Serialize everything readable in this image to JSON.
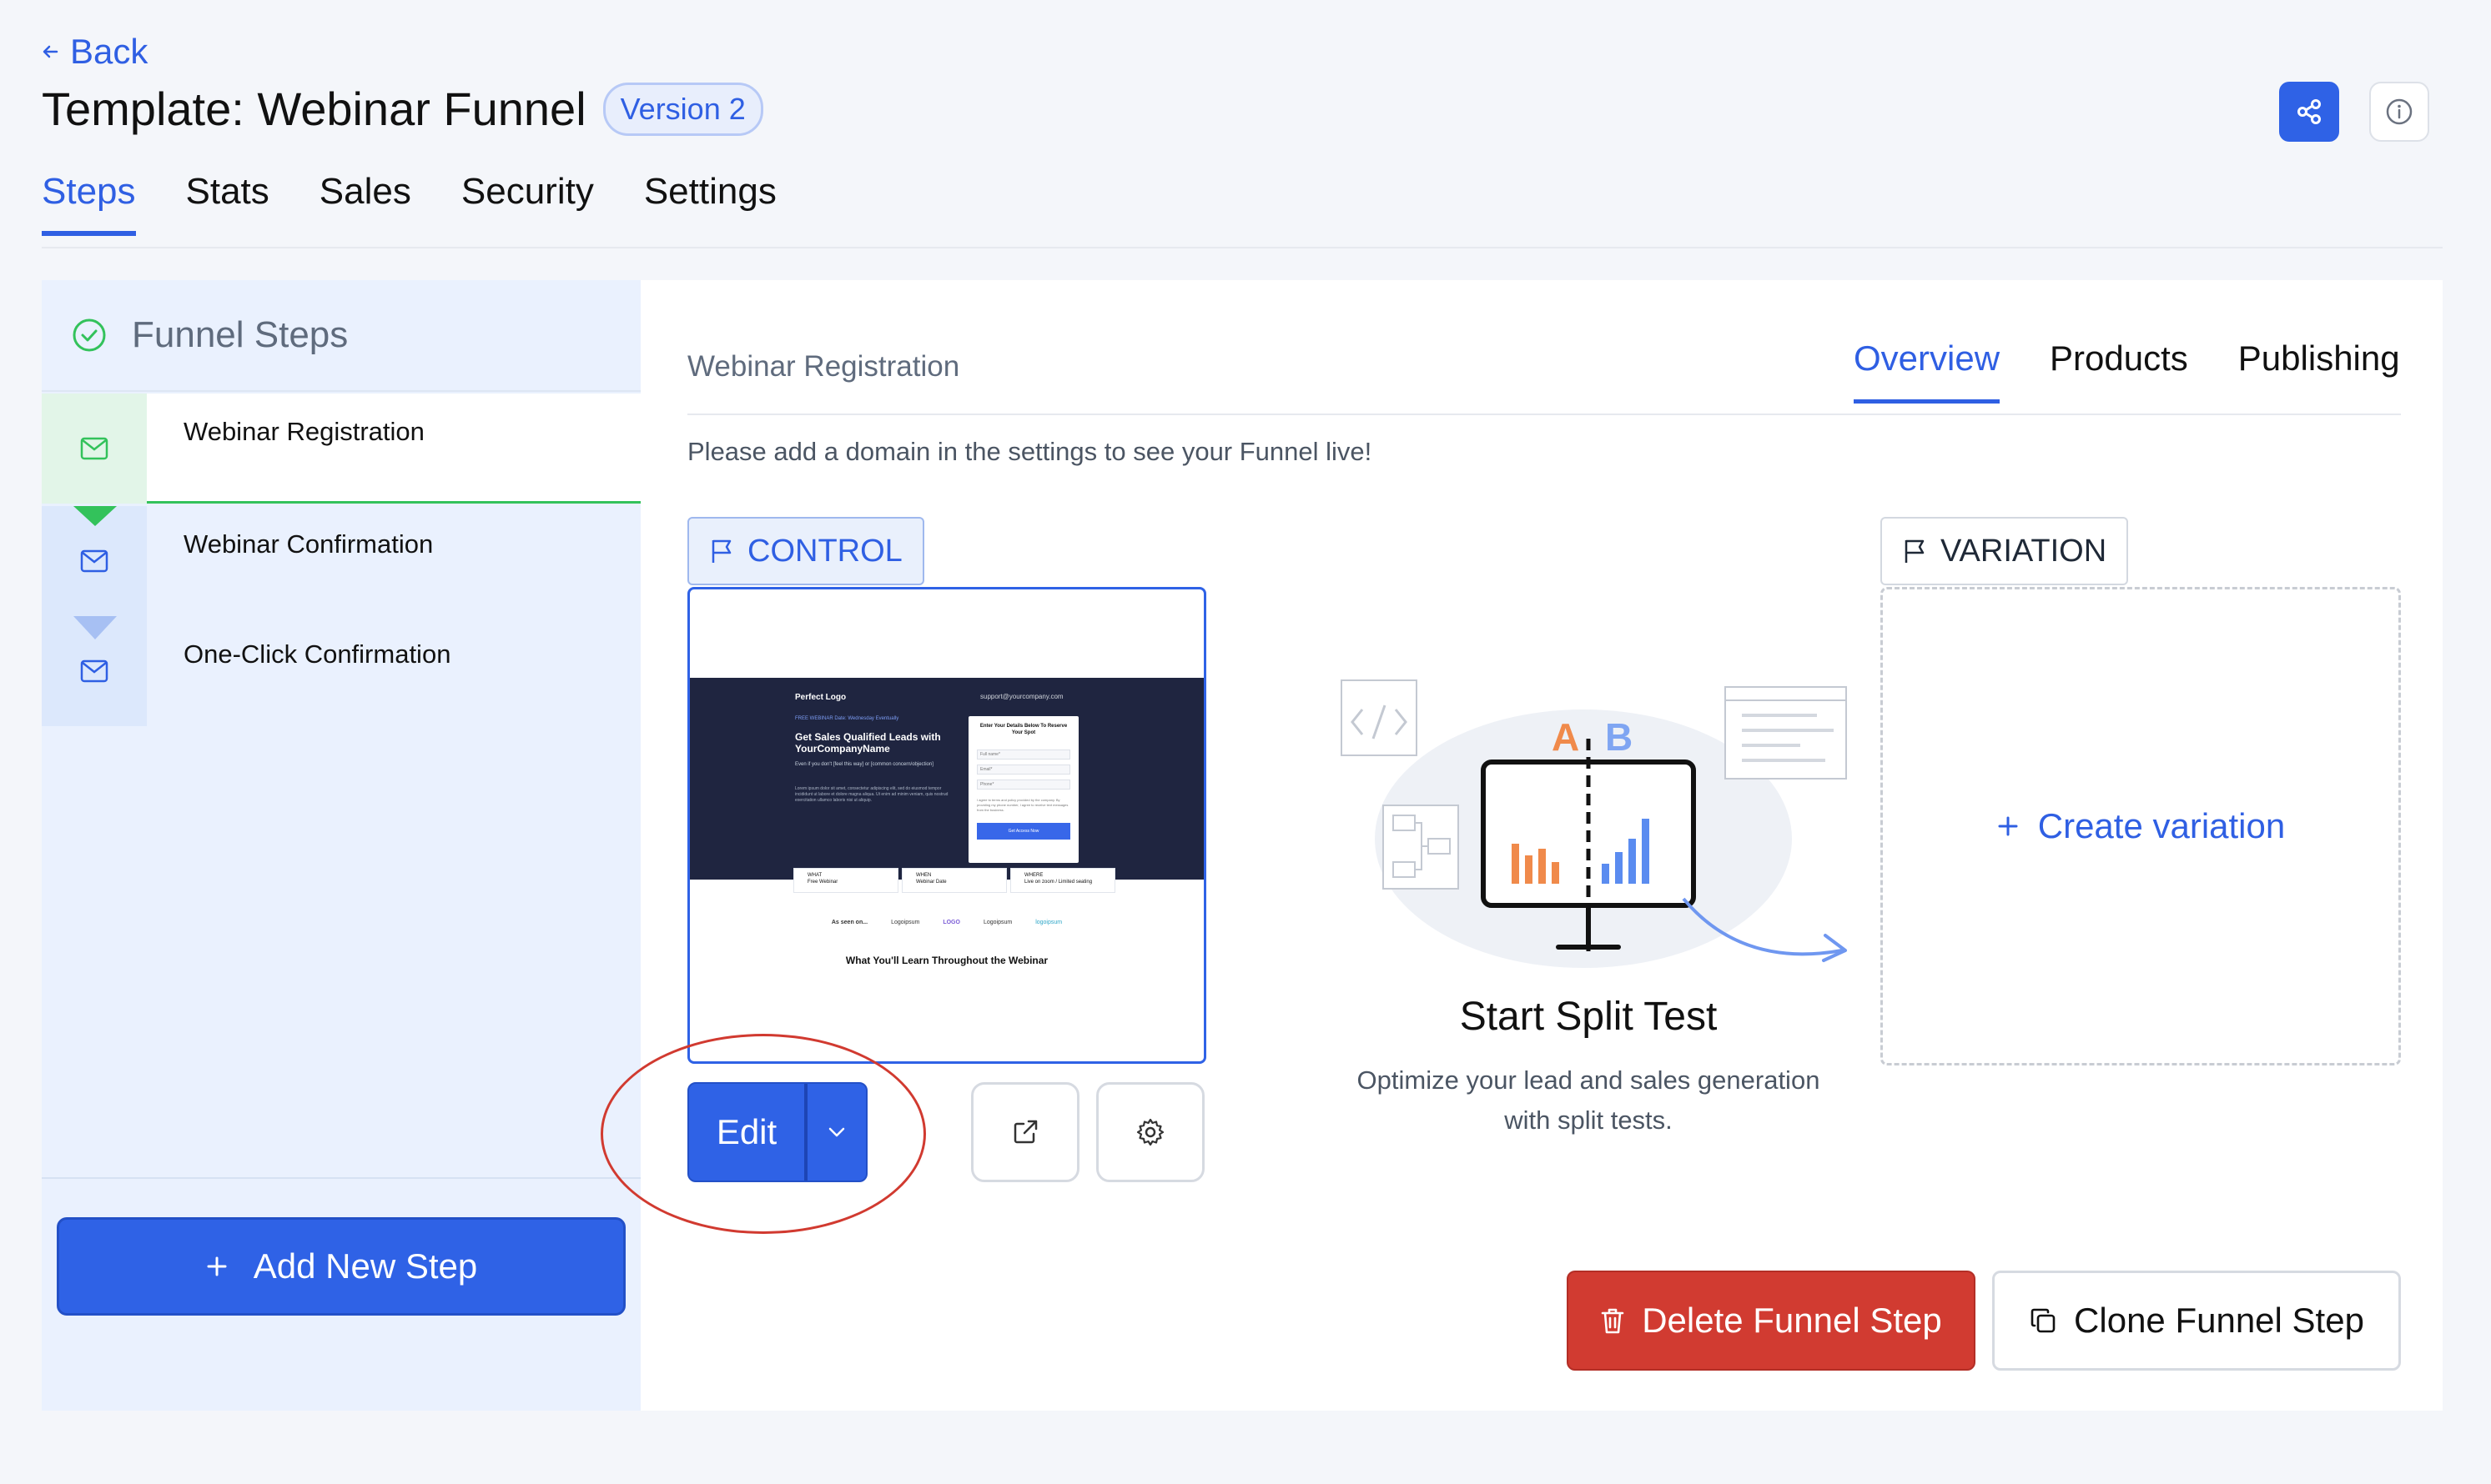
{
  "header": {
    "back_label": "Back",
    "title": "Template: Webinar Funnel",
    "version_badge": "Version 2"
  },
  "tabs": [
    "Steps",
    "Stats",
    "Sales",
    "Security",
    "Settings"
  ],
  "sidebar": {
    "title": "Funnel Steps",
    "steps": [
      {
        "label": "Webinar Registration",
        "icon": "mail-icon"
      },
      {
        "label": "Webinar Confirmation",
        "icon": "mail-icon"
      },
      {
        "label": "One-Click Confirmation",
        "icon": "mail-icon"
      }
    ],
    "add_step_label": "Add New Step"
  },
  "main": {
    "step_title": "Webinar Registration",
    "tabs": [
      "Overview",
      "Products",
      "Publishing"
    ],
    "notice": "Please add a domain in the settings to see your Funnel live!",
    "control_label": "CONTROL",
    "variation_label": "VARIATION",
    "edit_label": "Edit",
    "create_variation_label": "Create variation",
    "split_test": {
      "title": "Start Split Test",
      "description_line1": "Optimize your lead and sales generation",
      "description_line2": "with split tests.",
      "label_a": "A",
      "label_b": "B"
    },
    "delete_label": "Delete Funnel Step",
    "clone_label": "Clone Funnel Step"
  },
  "preview": {
    "logo": "Perfect Logo",
    "email": "support@yourcompany.com",
    "small_label": "FREE WEBINAR  Date: Wednesday Eventually",
    "headline": "Get Sales Qualified Leads with YourCompanyName",
    "sub": "Even if you don't [feel this way] or [common concern/objection]",
    "lorem": "Lorem ipsum dolor sit amet, consectetur adipiscing elit, sed do eiusmod tempor incididunt ut labore et dolore magna aliqua. Ut enim ad minim veniam, quis nostrud exercitation ullamco laboris nisi ut aliquip.",
    "form_title": "Enter Your Details Below To Reserve Your Spot",
    "field1": "Full name*",
    "field2": "Email*",
    "field3": "Phone*",
    "consent": "I agree to terms and policy provided by the company. By providing my phone number, I agree to receive text messages from the business.",
    "submit": "Get Access Now",
    "info": [
      {
        "title": "WHAT",
        "value": "Free Webinar"
      },
      {
        "title": "WHEN",
        "value": "Webinar Date"
      },
      {
        "title": "WHERE",
        "value": "Live on zoom / Limited seating"
      }
    ],
    "seen_on": "As seen on...",
    "logos": [
      "Logoipsum",
      "LOGO",
      "Logoipsum",
      "logoipsum"
    ],
    "learn_title": "What You'll Learn Throughout the Webinar"
  },
  "colors": {
    "accent": "#2f62e6",
    "danger": "#d13b31",
    "success": "#33c25b",
    "annotation": "#d13a30"
  }
}
